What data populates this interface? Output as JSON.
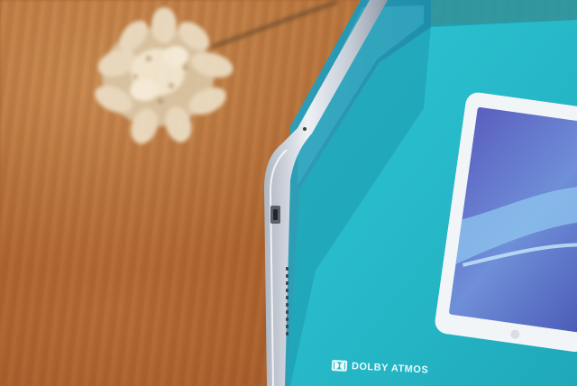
{
  "photo": {
    "description_type": "photograph",
    "background_color": "#a8622e",
    "box_color": "#2fbfcc",
    "tablet_color": "#c9cfd8"
  },
  "box": {
    "logo_label": "DOLBY ATMOS"
  }
}
